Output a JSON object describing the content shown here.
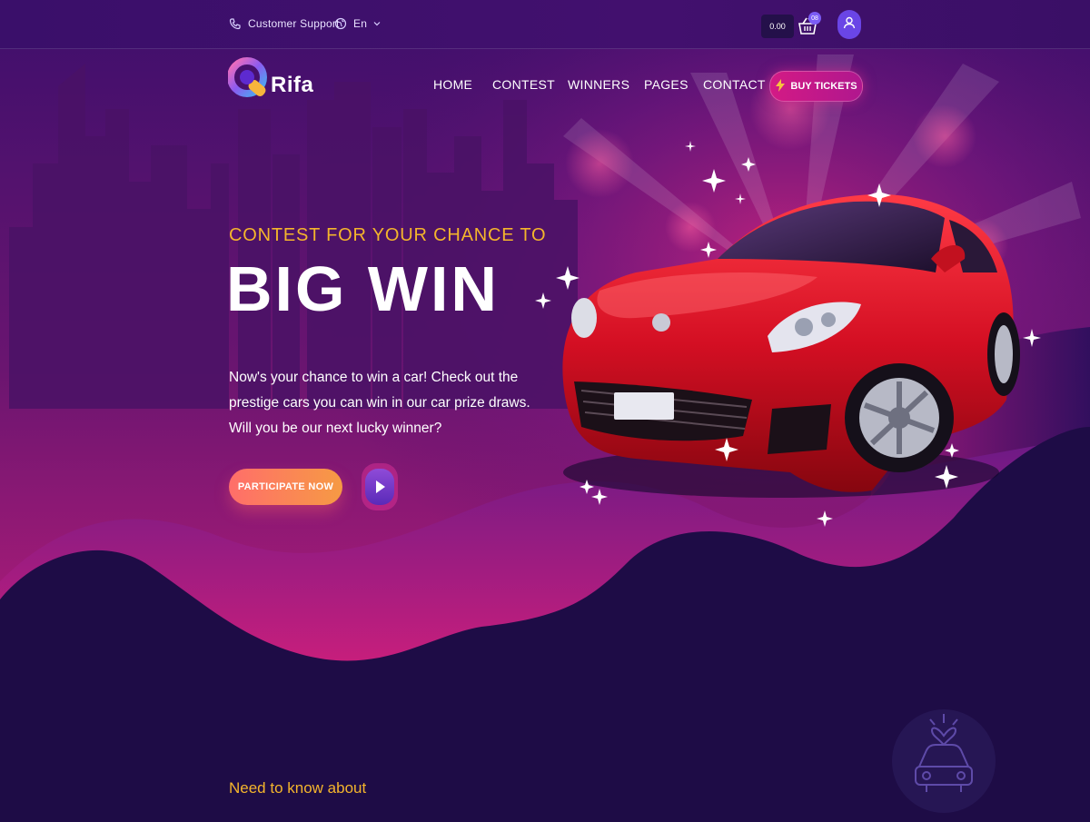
{
  "topbar": {
    "support_label": "Customer Support",
    "language": "En",
    "cart_amount": "0.00",
    "cart_count": "08"
  },
  "brand": {
    "name": "Rifa"
  },
  "nav": {
    "items": [
      "HOME",
      "CONTEST",
      "WINNERS",
      "PAGES",
      "CONTACT"
    ],
    "buy_label": "BUY TICKETS"
  },
  "hero": {
    "eyebrow": "CONTEST FOR YOUR CHANCE TO",
    "title": "BIG WIN",
    "description": "Now's your chance to win a car! Check out the prestige cars you can win in our car prize draws. Will you be our next lucky winner?",
    "cta": "PARTICIPATE NOW"
  },
  "section": {
    "heading": "Need to know about"
  },
  "colors": {
    "accent": "#f4b52c",
    "primary": "#6a45e6",
    "button_gradient_start": "#ff6e6a",
    "button_gradient_end": "#f69a44",
    "buy_button": "#d31a85",
    "background_dark": "#1e0c46"
  },
  "icons": {
    "support": "headset-icon",
    "language": "globe-icon",
    "cart": "basket-icon",
    "user": "user-icon",
    "buy": "lightning-icon",
    "play": "play-icon",
    "gift": "gift-car-icon"
  }
}
